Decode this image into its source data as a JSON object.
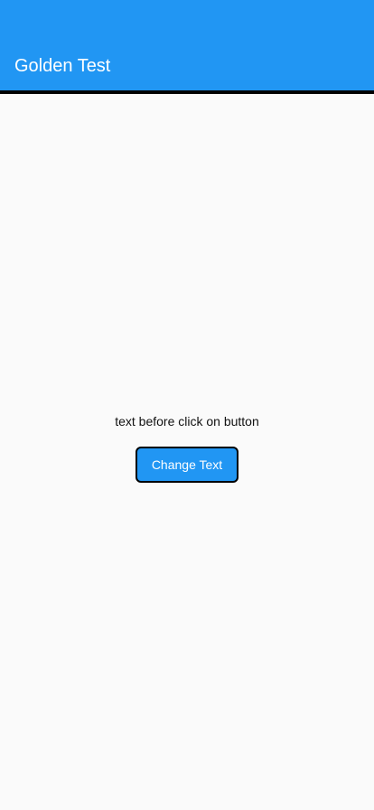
{
  "app_bar": {
    "title": "Golden Test",
    "color": "#2196f3"
  },
  "main": {
    "status_text": "text before click on button",
    "button_label": "Change Text",
    "button_color": "#2196f3"
  }
}
